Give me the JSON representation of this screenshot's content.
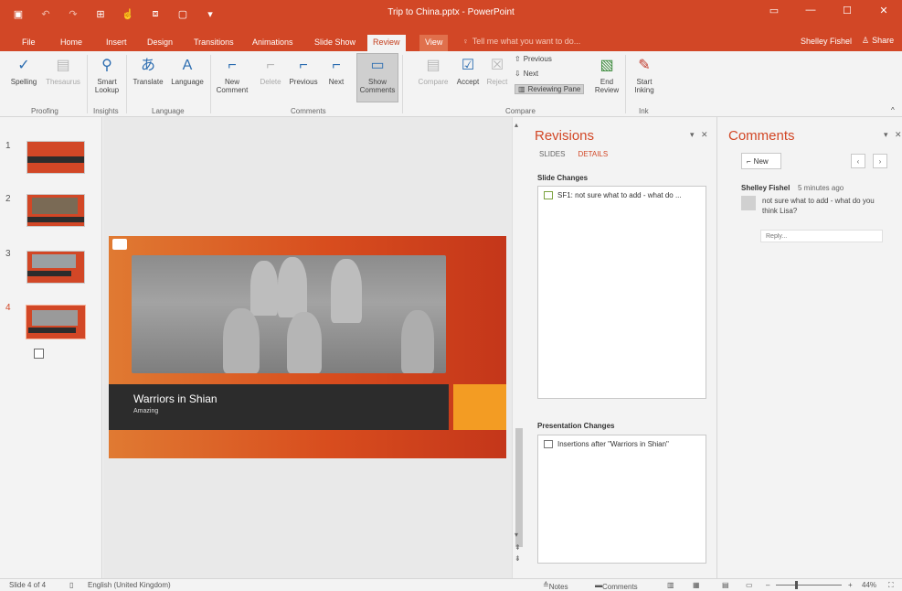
{
  "window": {
    "title": "Trip to China.pptx - PowerPoint",
    "accent": "#d24726"
  },
  "quick_access": [
    {
      "icon": "save-icon"
    },
    {
      "icon": "undo-icon"
    },
    {
      "icon": "redo-icon"
    },
    {
      "icon": "start-from-beginning-icon"
    },
    {
      "icon": "touch-mode-icon"
    },
    {
      "icon": "screenshot-icon"
    },
    {
      "icon": "new-slide-icon"
    },
    {
      "icon": "customize-qat-icon"
    }
  ],
  "tabs": [
    "File",
    "Home",
    "Insert",
    "Design",
    "Transitions",
    "Animations",
    "Slide Show",
    "Review",
    "View"
  ],
  "active_tab": "Review",
  "tell_me": "Tell me what you want to do...",
  "user": {
    "name": "Shelley Fishel",
    "share_label": "Share"
  },
  "ribbon": {
    "spelling": "Spelling",
    "thesaurus": "Thesaurus",
    "smart_lookup_1": "Smart",
    "smart_lookup_2": "Lookup",
    "translate": "Translate",
    "language": "Language",
    "new_comment_1": "New",
    "new_comment_2": "Comment",
    "delete": "Delete",
    "previous": "Previous",
    "next": "Next",
    "show_comments_1": "Show",
    "show_comments_2": "Comments",
    "compare": "Compare",
    "accept": "Accept",
    "reject": "Reject",
    "prev_small": "Previous",
    "next_small": "Next",
    "reviewing_pane": "Reviewing Pane",
    "end_review_1": "End",
    "end_review_2": "Review",
    "start_inking_1": "Start",
    "start_inking_2": "Inking",
    "groups": {
      "proofing": "Proofing",
      "insights": "Insights",
      "language": "Language",
      "comments": "Comments",
      "compare": "Compare",
      "ink": "Ink"
    }
  },
  "thumbnails": [
    "1",
    "2",
    "3",
    "4"
  ],
  "selected_slide": 4,
  "slide": {
    "title": "Warriors in Shian",
    "subtitle": "Amazing"
  },
  "revisions": {
    "title": "Revisions",
    "tab_slides": "SLIDES",
    "tab_details": "DETAILS",
    "slide_changes_label": "Slide Changes",
    "slide_change_item": "SF1: not sure what to add - what do ...",
    "presentation_changes_label": "Presentation Changes",
    "presentation_change_item": "Insertions after \"Warriors in Shian\""
  },
  "comments": {
    "title": "Comments",
    "new_label": "New",
    "author": "Shelley Fishel",
    "time": "5 minutes ago",
    "text": "not sure what to add - what do you think Lisa?",
    "reply_placeholder": "Reply..."
  },
  "status": {
    "slide_info": "Slide 4 of 4",
    "language": "English (United Kingdom)",
    "notes": "Notes",
    "comments": "Comments",
    "zoom": "44%"
  }
}
